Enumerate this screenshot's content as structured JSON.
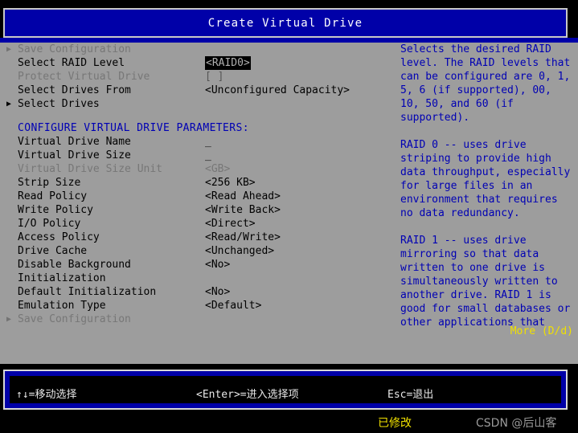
{
  "window": {
    "title": "Create Virtual Drive"
  },
  "colors": {
    "title_bg": "#0000a8",
    "body_bg": "#9d9d9d",
    "heading_blue": "#0000b4",
    "highlight_bg": "#000000",
    "highlight_fg": "#b0b0b0",
    "accent_yellow": "#f0e000",
    "disabled_gray": "#777777"
  },
  "menu": {
    "top_items": [
      {
        "arrow": "▶",
        "label": "Save Configuration",
        "value": "",
        "disabled": true,
        "selected": false
      },
      {
        "arrow": "",
        "label": "Select RAID Level",
        "value": "<RAID0>",
        "disabled": false,
        "selected": true
      },
      {
        "arrow": "",
        "label": "Protect Virtual Drive",
        "value": "[ ]",
        "disabled": true,
        "selected": false
      },
      {
        "arrow": "",
        "label": "Select Drives From",
        "value": "<Unconfigured Capacity>",
        "disabled": false,
        "selected": false
      },
      {
        "arrow": "▶",
        "label": "Select Drives",
        "value": "",
        "disabled": false,
        "selected": false
      }
    ],
    "section_heading": "CONFIGURE VIRTUAL DRIVE PARAMETERS:",
    "param_items": [
      {
        "arrow": "",
        "label": "Virtual Drive Name",
        "value": "_",
        "disabled": false,
        "selected": false
      },
      {
        "arrow": "",
        "label": "Virtual Drive Size",
        "value": "_",
        "disabled": false,
        "selected": false
      },
      {
        "arrow": "",
        "label": "Virtual Drive Size Unit",
        "value": "<GB>",
        "disabled": true,
        "selected": false
      },
      {
        "arrow": "",
        "label": "Strip Size",
        "value": "<256 KB>",
        "disabled": false,
        "selected": false
      },
      {
        "arrow": "",
        "label": "Read Policy",
        "value": "<Read Ahead>",
        "disabled": false,
        "selected": false
      },
      {
        "arrow": "",
        "label": "Write Policy",
        "value": "<Write Back>",
        "disabled": false,
        "selected": false
      },
      {
        "arrow": "",
        "label": "I/O Policy",
        "value": "<Direct>",
        "disabled": false,
        "selected": false
      },
      {
        "arrow": "",
        "label": "Access Policy",
        "value": "<Read/Write>",
        "disabled": false,
        "selected": false
      },
      {
        "arrow": "",
        "label": "Drive Cache",
        "value": "<Unchanged>",
        "disabled": false,
        "selected": false
      },
      {
        "arrow": "",
        "label": "Disable Background",
        "value": "<No>",
        "disabled": false,
        "selected": false
      },
      {
        "arrow": "",
        "label": "Initialization",
        "value": "",
        "disabled": false,
        "selected": false
      },
      {
        "arrow": "",
        "label": "Default Initialization",
        "value": "<No>",
        "disabled": false,
        "selected": false
      },
      {
        "arrow": "",
        "label": "Emulation Type",
        "value": "<Default>",
        "disabled": false,
        "selected": false
      },
      {
        "arrow": "▶",
        "label": "Save Configuration",
        "value": "",
        "disabled": true,
        "selected": false
      }
    ]
  },
  "help": {
    "paragraphs": [
      "Selects the desired RAID level. The RAID levels that can be configured are 0, 1, 5, 6 (if supported), 00, 10, 50, and 60 (if supported).",
      "RAID 0 -- uses drive striping to provide high data throughput, especially for large files in an environment that requires no data redundancy.",
      "RAID 1 -- uses drive mirroring so that data written to one drive is simultaneously written to another drive. RAID 1 is good for small databases or other applications that"
    ],
    "more_label": "More  (D/d)"
  },
  "footer": {
    "hints": [
      {
        "keys": "↑↓",
        "text": "=移动选择"
      },
      {
        "keys": "<Enter>",
        "text": "=进入选择项"
      },
      {
        "keys": "Esc",
        "text": "=退出"
      }
    ],
    "hint_move": "↑↓=移动选择",
    "hint_enter": "<Enter>=进入选择项",
    "hint_esc": "Esc=退出",
    "status_modified": "已修改",
    "watermark": "CSDN @后山客"
  }
}
